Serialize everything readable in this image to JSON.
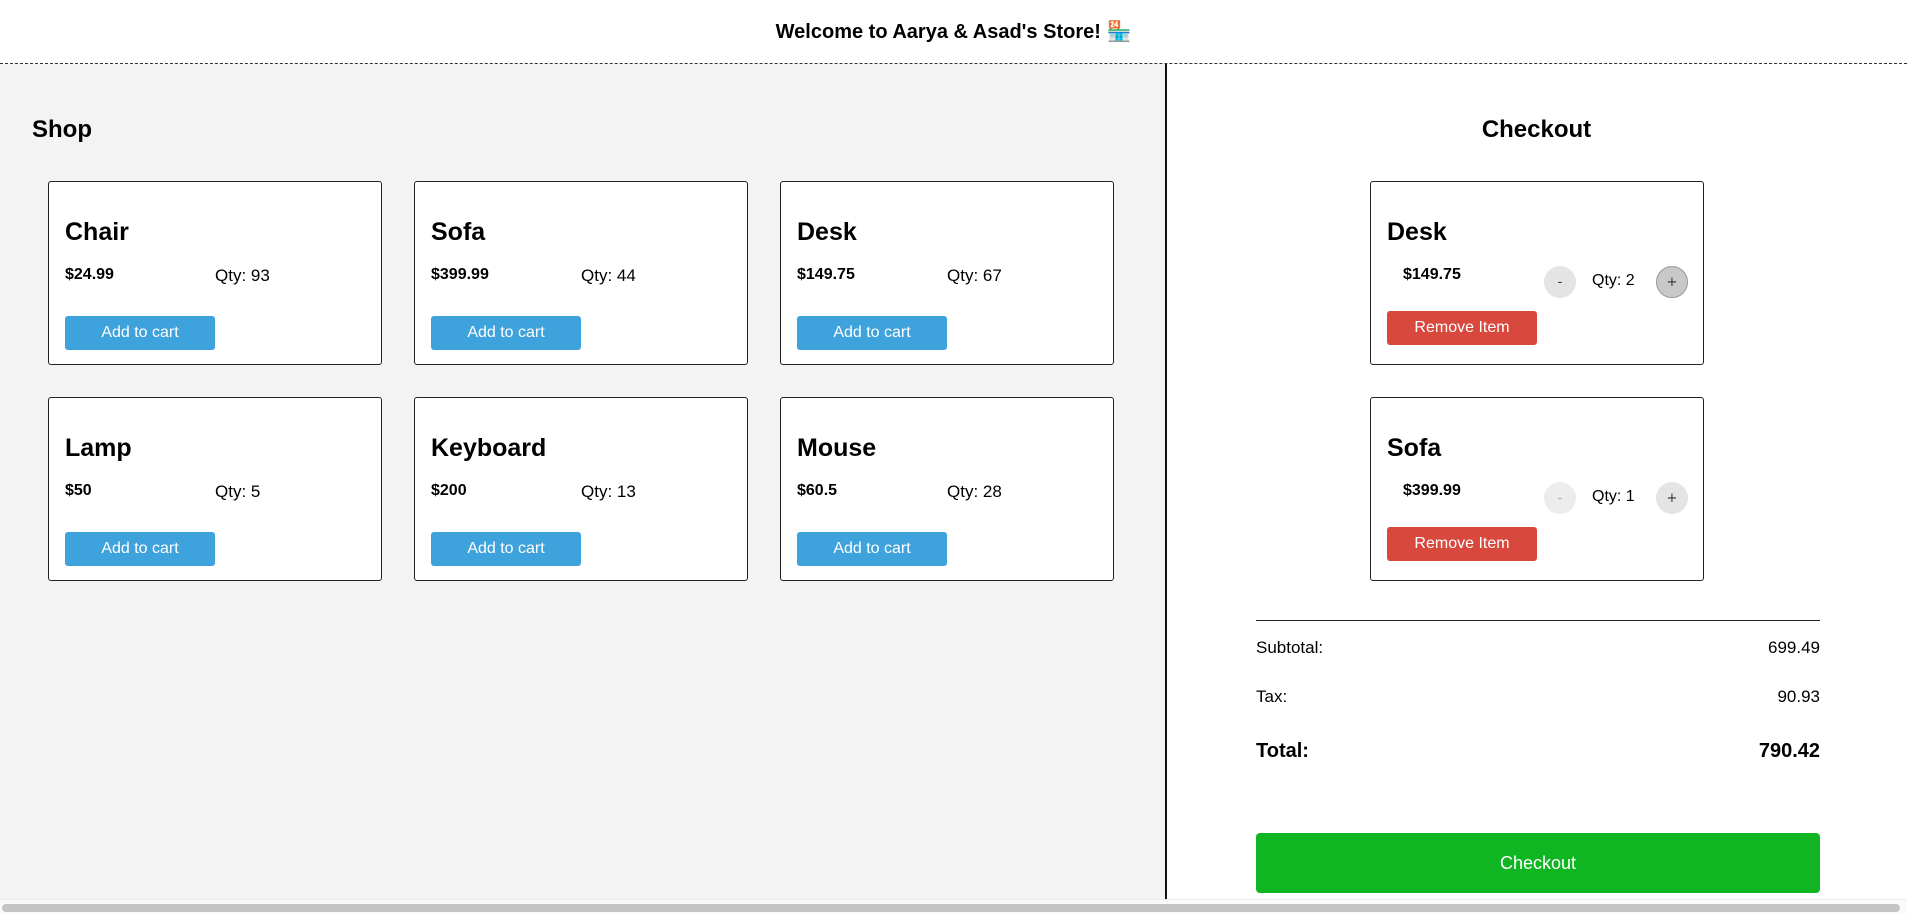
{
  "header": {
    "title": "Welcome to Aarya & Asad's Store! 🏪"
  },
  "shop": {
    "title": "Shop",
    "add_label": "Add to cart",
    "products": [
      {
        "name": "Chair",
        "price": "$24.99",
        "qty": "Qty: 93"
      },
      {
        "name": "Sofa",
        "price": "$399.99",
        "qty": "Qty: 44"
      },
      {
        "name": "Desk",
        "price": "$149.75",
        "qty": "Qty: 67"
      },
      {
        "name": "Lamp",
        "price": "$50",
        "qty": "Qty: 5"
      },
      {
        "name": "Keyboard",
        "price": "$200",
        "qty": "Qty: 13"
      },
      {
        "name": "Mouse",
        "price": "$60.5",
        "qty": "Qty: 28"
      }
    ]
  },
  "checkout": {
    "title": "Checkout",
    "remove_label": "Remove Item",
    "minus_label": "-",
    "plus_label": "+",
    "items": [
      {
        "name": "Desk",
        "price": "$149.75",
        "qty": "Qty: 2"
      },
      {
        "name": "Sofa",
        "price": "$399.99",
        "qty": "Qty: 1"
      }
    ],
    "subtotal_label": "Subtotal:",
    "subtotal_value": "699.49",
    "tax_label": "Tax:",
    "tax_value": "90.93",
    "total_label": "Total:",
    "total_value": "790.42",
    "checkout_label": "Checkout"
  },
  "colors": {
    "add_button": "#3ea2dc",
    "remove_button": "#d9483c",
    "checkout_button": "#10b522",
    "shop_background": "#f3f3f3"
  }
}
